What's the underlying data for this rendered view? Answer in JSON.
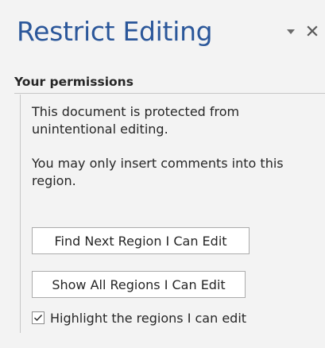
{
  "pane": {
    "title": "Restrict Editing",
    "options_icon": "chevron-down-icon",
    "close_icon": "close-icon"
  },
  "permissions": {
    "header": "Your permissions",
    "paragraph_1": "This document is protected from unintentional editing.",
    "paragraph_2": "You may only insert comments into this region.",
    "find_next_button": "Find Next Region I Can Edit",
    "show_all_button": "Show All Regions I Can Edit",
    "highlight_checkbox": {
      "label": "Highlight the regions I can edit",
      "checked": true,
      "icon": "checkmark-icon"
    }
  },
  "colors": {
    "title": "#2b579a",
    "background": "#f3f3f3",
    "text": "#262626",
    "button_border": "#ababab"
  }
}
